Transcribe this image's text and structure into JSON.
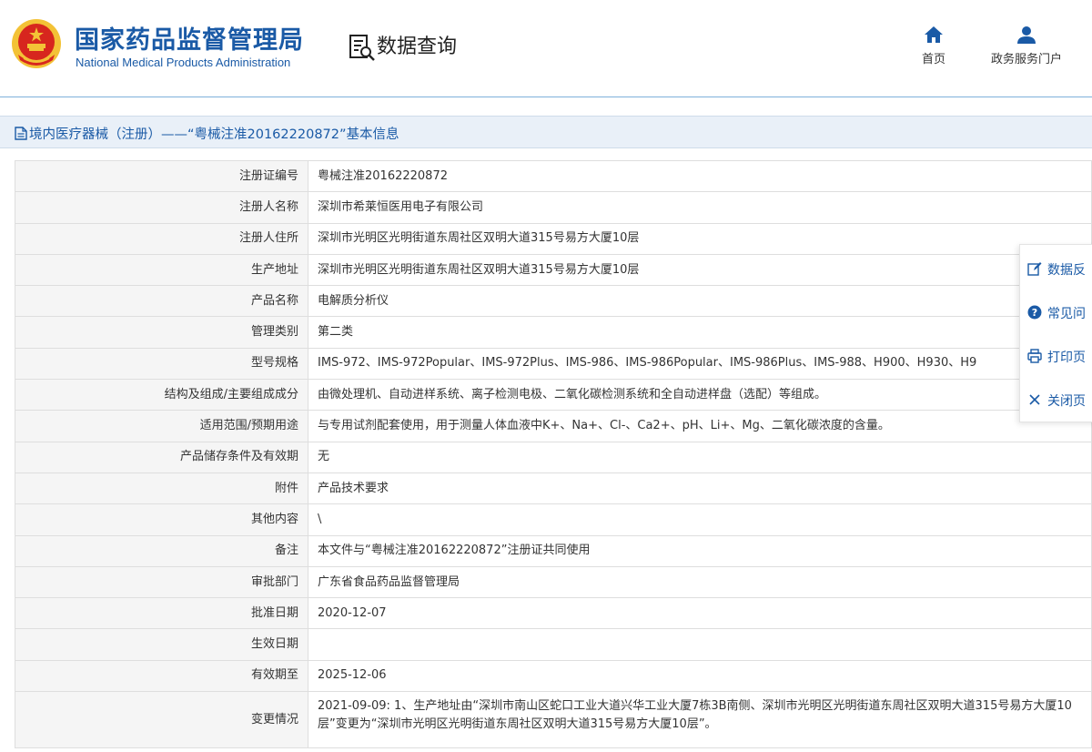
{
  "header": {
    "brand_cn": "国家药品监督管理局",
    "brand_en": "National Medical Products Administration",
    "query_title": "数据查询",
    "nav": [
      {
        "label": "首页",
        "icon": "home-icon"
      },
      {
        "label": "政务服务门户",
        "icon": "user-icon"
      }
    ]
  },
  "section": {
    "title": "境内医疗器械（注册）——“粤械注准20162220872”基本信息",
    "icon": "document-icon"
  },
  "rows": [
    {
      "label": "注册证编号",
      "value": "粤械注准20162220872"
    },
    {
      "label": "注册人名称",
      "value": "深圳市希莱恒医用电子有限公司"
    },
    {
      "label": "注册人住所",
      "value": "深圳市光明区光明街道东周社区双明大道315号易方大厦10层"
    },
    {
      "label": "生产地址",
      "value": "深圳市光明区光明街道东周社区双明大道315号易方大厦10层"
    },
    {
      "label": "产品名称",
      "value": "电解质分析仪"
    },
    {
      "label": "管理类别",
      "value": "第二类"
    },
    {
      "label": "型号规格",
      "value": "IMS-972、IMS-972Popular、IMS-972Plus、IMS-986、IMS-986Popular、IMS-986Plus、IMS-988、H900、H930、H9"
    },
    {
      "label": "结构及组成/主要组成成分",
      "value": "由微处理机、自动进样系统、离子检测电极、二氧化碳检测系统和全自动进样盘（选配）等组成。"
    },
    {
      "label": "适用范围/预期用途",
      "value": "与专用试剂配套使用，用于测量人体血液中K+、Na+、Cl-、Ca2+、pH、Li+、Mg、二氧化碳浓度的含量。"
    },
    {
      "label": "产品储存条件及有效期",
      "value": "无"
    },
    {
      "label": "附件",
      "value": "产品技术要求"
    },
    {
      "label": "其他内容",
      "value": "\\"
    },
    {
      "label": "备注",
      "value": "本文件与“粤械注准20162220872”注册证共同使用"
    },
    {
      "label": "审批部门",
      "value": "广东省食品药品监督管理局"
    },
    {
      "label": "批准日期",
      "value": "2020-12-07"
    },
    {
      "label": "生效日期",
      "value": ""
    },
    {
      "label": "有效期至",
      "value": "2025-12-06"
    },
    {
      "label": "变更情况",
      "value": "2021-09-09: 1、生产地址由“深圳市南山区蛇口工业大道兴华工业大厦7栋3B南侧、深圳市光明区光明街道东周社区双明大道315号易方大厦10层”变更为“深圳市光明区光明街道东周社区双明大道315号易方大厦10层”。"
    }
  ],
  "side_panel": [
    {
      "label": "数据反",
      "icon": "edit-icon"
    },
    {
      "label": "常见问",
      "icon": "question-icon"
    },
    {
      "label": "打印页",
      "icon": "print-icon"
    },
    {
      "label": "关闭页",
      "icon": "close-icon"
    }
  ],
  "colors": {
    "brand": "#1a5aa6",
    "emblem_red": "#d7261e",
    "emblem_gold": "#f3c236",
    "section_bg": "#e9f0f8",
    "label_bg": "#f5f5f5"
  }
}
